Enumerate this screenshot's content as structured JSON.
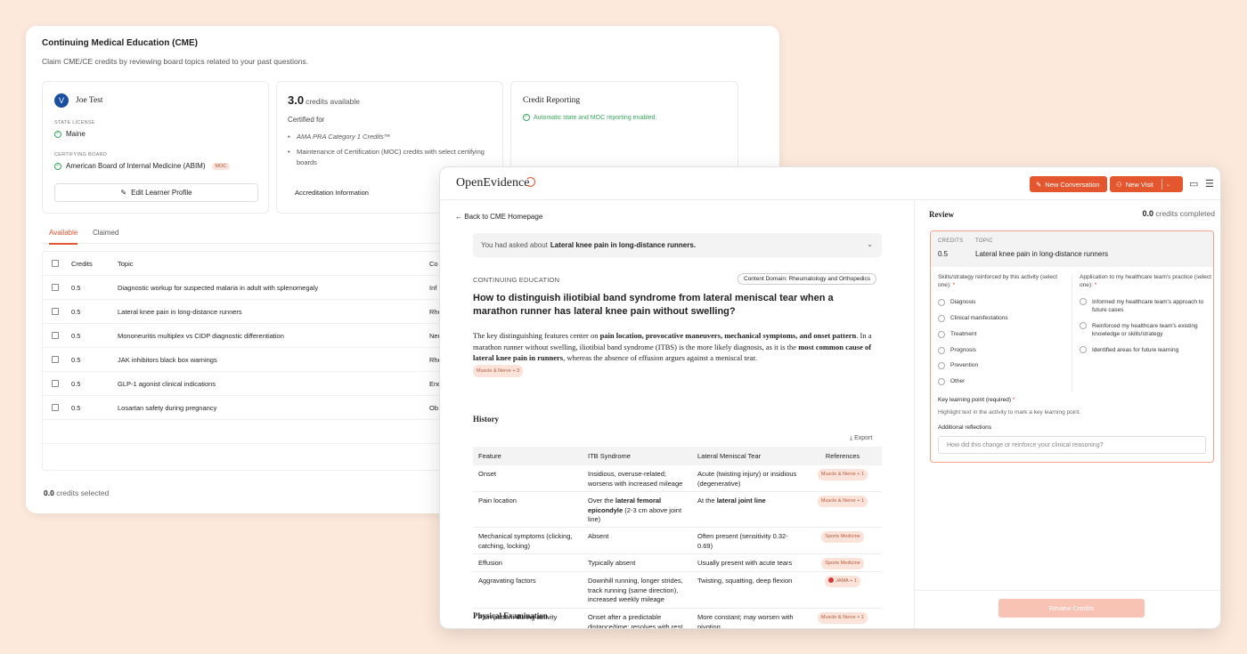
{
  "cme": {
    "title": "Continuing Medical Education (CME)",
    "subtitle": "Claim CME/CE credits by reviewing board topics related to your past questions.",
    "learner": {
      "avatar_initial": "V",
      "name": "Joe Test",
      "state_license_label": "STATE LICENSE",
      "state": "Maine",
      "certifying_board_label": "CERTIFYING BOARD",
      "board": "American Board of Internal Medicine (ABIM)",
      "board_badge": "MOC",
      "edit_button": "Edit Learner Profile"
    },
    "credits_card": {
      "amount": "3.0",
      "amount_label": "credits available",
      "certified_for": "Certified for",
      "items": [
        "AMA PRA Category 1 Credits™",
        "Maintenance of Certification (MOC) credits with select certifying boards"
      ],
      "accreditation_link": "Accreditation Information"
    },
    "reporting_card": {
      "title": "Credit Reporting",
      "note": "Automatic state and MOC reporting enabled."
    },
    "tabs": [
      "Available",
      "Claimed"
    ],
    "table": {
      "headers": {
        "credits": "Credits",
        "topic": "Topic",
        "category": "Co"
      },
      "rows": [
        {
          "credits": "0.5",
          "topic": "Diagnostic workup for suspected malaria in adult with splenomegaly",
          "category": "Inf"
        },
        {
          "credits": "0.5",
          "topic": "Lateral knee pain in long-distance runners",
          "category": "Rhe"
        },
        {
          "credits": "0.5",
          "topic": "Mononeuritis multiplex vs CIDP diagnostic differentiation",
          "category": "Neu"
        },
        {
          "credits": "0.5",
          "topic": "JAK inhibitors black box warnings",
          "category": "Rhe"
        },
        {
          "credits": "0.5",
          "topic": "GLP-1 agonist clinical indications",
          "category": "End"
        },
        {
          "credits": "0.5",
          "topic": "Losartan safety during pregnancy",
          "category": "Ob"
        }
      ]
    },
    "credits_selected_value": "0.0",
    "credits_selected_label": "credits selected"
  },
  "oe": {
    "logo": "OpenEvidence",
    "new_conversation": "New Conversation",
    "new_visit": "New Visit",
    "back_link": "Back to CME Homepage",
    "asked_prefix": "You had asked about",
    "asked_topic": "Lateral knee pain in long-distance runners.",
    "section_label": "CONTINUING EDUCATION",
    "domain_pill": "Content Domain: Rheumatology and Orthopedics",
    "question": "How to distinguish iliotibial band syndrome from lateral meniscal tear when a marathon runner has lateral knee pain without swelling?",
    "paragraph": {
      "p1": "The key distinguishing features center on ",
      "b1": "pain location, provocative maneuvers, mechanical symptoms, and onset pattern",
      "p2": ". In a marathon runner without swelling, iliotibial band syndrome (ITBS) is the more likely diagnosis, as it is the ",
      "b2": "most common cause of lateral knee pain in runners",
      "p3": ", whereas the absence of effusion argues against a meniscal tear.",
      "cite": "Muscle & Nerve + 3"
    },
    "history_heading": "History",
    "export_label": "Export",
    "table": {
      "headers": {
        "feature": "Feature",
        "itb": "ITB Syndrome",
        "mt": "Lateral Meniscal Tear",
        "ref": "References"
      },
      "rows": [
        {
          "feature": "Onset",
          "itb": "Insidious, overuse-related; worsens with increased mileage",
          "mt": "Acute (twisting injury) or insidious (degenerative)",
          "ref": "Muscle & Nerve + 1"
        },
        {
          "feature": "Pain location",
          "itb_pre": "Over the ",
          "itb_bold": "lateral femoral epicondyle",
          "itb_post": " (2-3 cm above joint line)",
          "mt_pre": "At the ",
          "mt_bold": "lateral joint line",
          "ref": "Muscle & Nerve + 1"
        },
        {
          "feature": "Mechanical symptoms (clicking, catching, locking)",
          "itb": "Absent",
          "mt": "Often present (sensitivity 0.32-0.69)",
          "ref": "Sports Medicine"
        },
        {
          "feature": "Effusion",
          "itb": "Typically absent",
          "mt": "Usually present with acute tears",
          "ref": "Sports Medicine"
        },
        {
          "feature": "Aggravating factors",
          "itb": "Downhill running, longer strides, track running (same direction), increased weekly mileage",
          "mt": "Twisting, squatting, deep flexion",
          "ref": "JAMA + 1"
        },
        {
          "feature": "Pain pattern during activity",
          "itb": "Onset after a predictable distance/time; resolves with rest",
          "mt": "More constant; may worsen with pivoting",
          "ref": "Muscle & Nerve + 1"
        }
      ]
    },
    "physical_heading": "Physical Examination",
    "review": {
      "title": "Review",
      "credits_value": "0.0",
      "credits_label": "credits completed",
      "credits_col_label": "CREDITS",
      "topic_col_label": "TOPIC",
      "credits": "0.5",
      "topic": "Lateral knee pain in long-distance runners",
      "skills_title": "Skills/strategy reinforced by this activity (select one):",
      "skills_options": [
        "Diagnosis",
        "Clinical manifestations",
        "Treatment",
        "Prognosis",
        "Prevention",
        "Other"
      ],
      "app_title": "Application to my healthcare team's practice (select one):",
      "app_options": [
        "Informed my healthcare team's approach to future cases",
        "Reinforced my healthcare team's existing knowledge or skills/strategy",
        "Identified areas for future learning"
      ],
      "key_point_label": "Key learning point (required)",
      "key_point_hint": "Highlight text in the activity to mark a key learning point.",
      "reflections_label": "Additional reflections",
      "reflections_placeholder": "How did this change or reinforce your clinical reasoning?",
      "submit": "Review Credits"
    }
  }
}
